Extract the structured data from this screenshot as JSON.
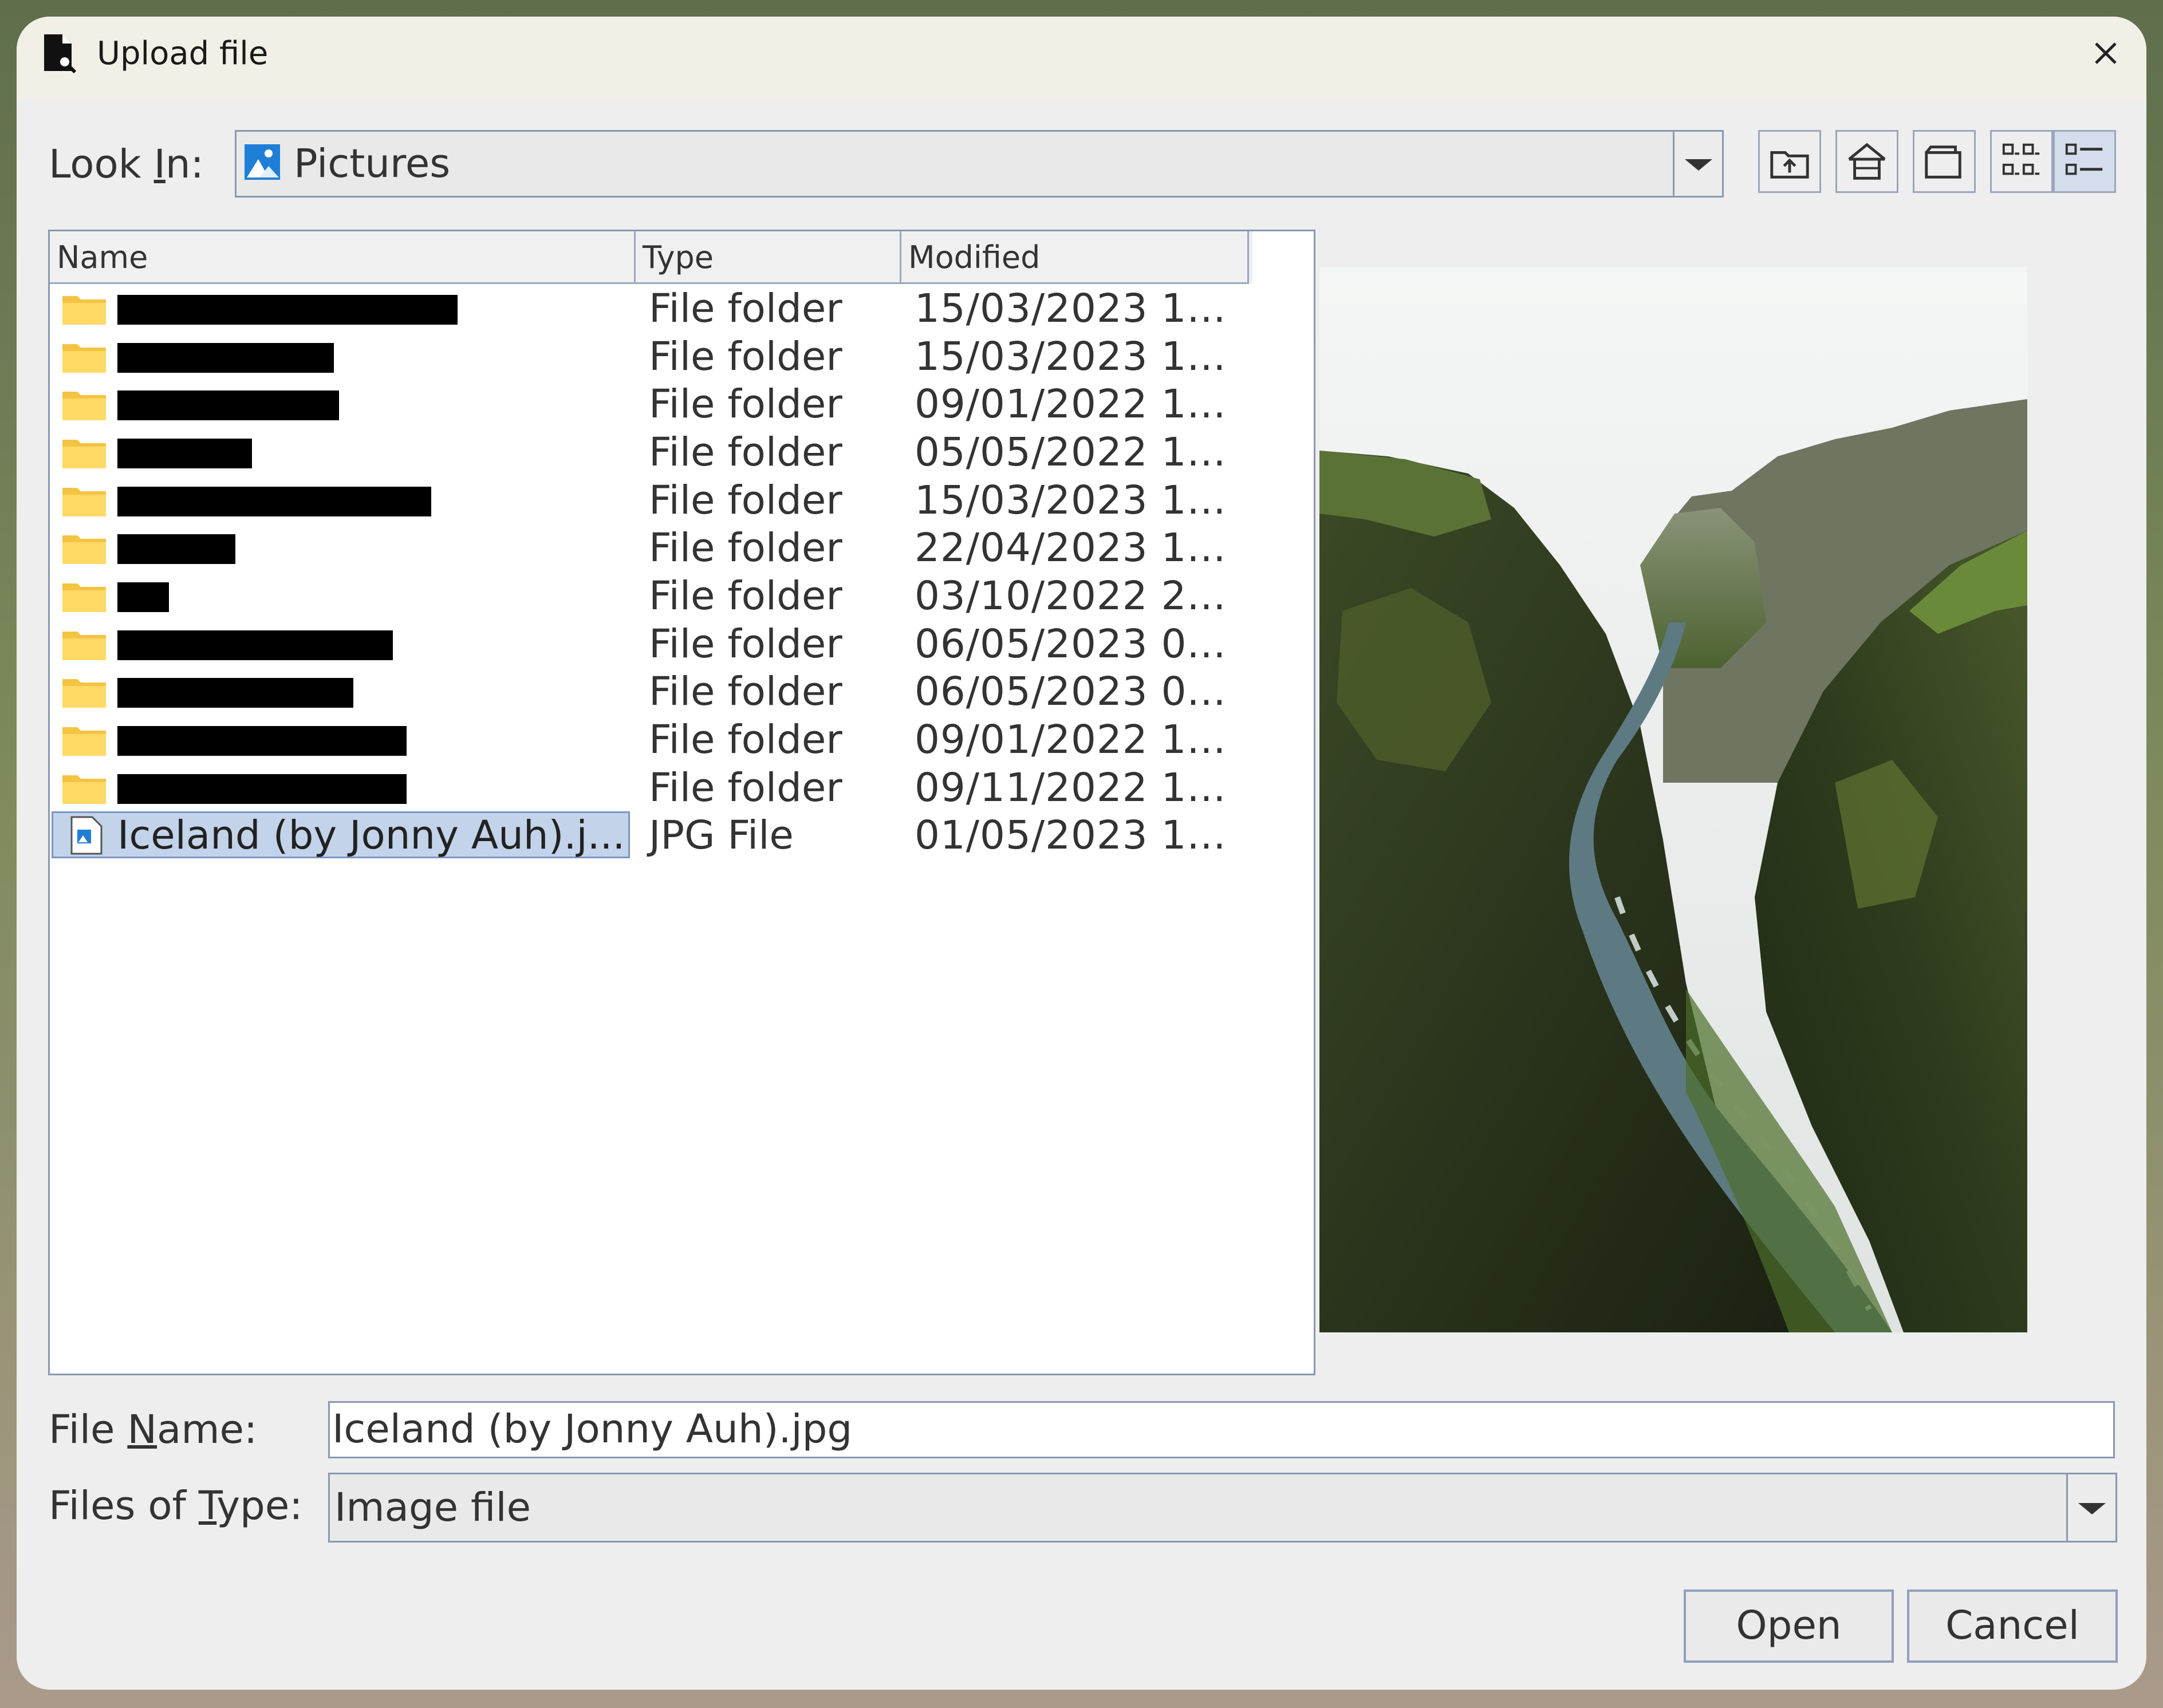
{
  "window": {
    "title": "Upload file"
  },
  "look_in": {
    "label_pre": "Look ",
    "label_accel": "I",
    "label_post": "n:",
    "value": "Pictures"
  },
  "toolbar": {
    "up_one_level_icon": "folder-up-icon",
    "home_icon": "home-icon",
    "new_folder_icon": "new-folder-icon",
    "list_view_icon": "list-view-icon",
    "details_view_icon": "details-view-icon"
  },
  "file_list": {
    "columns": [
      "Name",
      "Type",
      "Modified"
    ],
    "rows": [
      {
        "type": "File folder",
        "modified": "15/03/2023 1..."
      },
      {
        "type": "File folder",
        "modified": "15/03/2023 1..."
      },
      {
        "type": "File folder",
        "modified": "09/01/2022 1..."
      },
      {
        "type": "File folder",
        "modified": "05/05/2022 1..."
      },
      {
        "type": "File folder",
        "modified": "15/03/2023 1..."
      },
      {
        "type": "File folder",
        "modified": "22/04/2023 1..."
      },
      {
        "type": "File folder",
        "modified": "03/10/2022 2..."
      },
      {
        "type": "File folder",
        "modified": "06/05/2023 0..."
      },
      {
        "type": "File folder",
        "modified": "06/05/2023 0..."
      },
      {
        "type": "File folder",
        "modified": "09/01/2022 1..."
      },
      {
        "type": "File folder",
        "modified": "09/11/2022 1..."
      },
      {
        "name": "Iceland (by Jonny Auh).j...",
        "type": "JPG File",
        "modified": "01/05/2023 1..."
      }
    ]
  },
  "file_name": {
    "label_pre": "File ",
    "label_accel": "N",
    "label_post": "ame:",
    "value": "Iceland (by Jonny Auh).jpg"
  },
  "files_of_type": {
    "label_pre": "Files of ",
    "label_accel": "T",
    "label_post": "ype:",
    "value": "Image file"
  },
  "buttons": {
    "open": "Open",
    "cancel": "Cancel"
  }
}
